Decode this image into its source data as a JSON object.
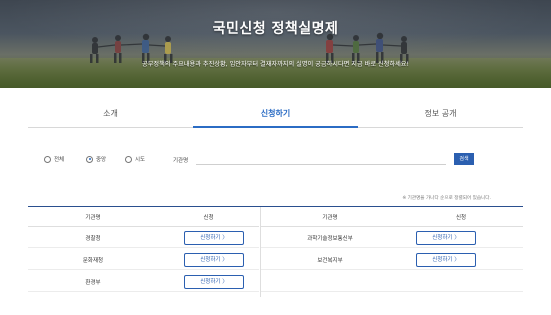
{
  "hero": {
    "title": "국민신청 정책실명제",
    "subtitle": "공부정책의 주요내용과 추진상황, 입안자부터 결재자까지의 실명이 궁금하시다면 지금 바로 신청하세요!"
  },
  "tabs": [
    {
      "label": "소개",
      "active": false
    },
    {
      "label": "신청하기",
      "active": true
    },
    {
      "label": "정보 공개",
      "active": false
    }
  ],
  "filter": {
    "options": [
      {
        "label": "전체",
        "checked": false
      },
      {
        "label": "중앙",
        "checked": true
      },
      {
        "label": "시도",
        "checked": false
      }
    ],
    "org_label": "기관명",
    "org_value": "",
    "search_label": "검색"
  },
  "note": "※ 기관명을 가나다 순으로 정렬되어 있습니다.",
  "table": {
    "headers": {
      "org": "기관명",
      "apply": "신청"
    },
    "left_rows": [
      {
        "org": "경찰청",
        "apply": "신청하기 〉"
      },
      {
        "org": "문화재청",
        "apply": "신청하기 〉"
      },
      {
        "org": "환경부",
        "apply": "신청하기 〉"
      }
    ],
    "right_rows": [
      {
        "org": "과학기술정보통신부",
        "apply": "신청하기 〉"
      },
      {
        "org": "보건복지부",
        "apply": "신청하기 〉"
      }
    ]
  },
  "colors": {
    "accent": "#2b6cc4",
    "button": "#2b5fb0",
    "table_top": "#2a4f8f"
  }
}
